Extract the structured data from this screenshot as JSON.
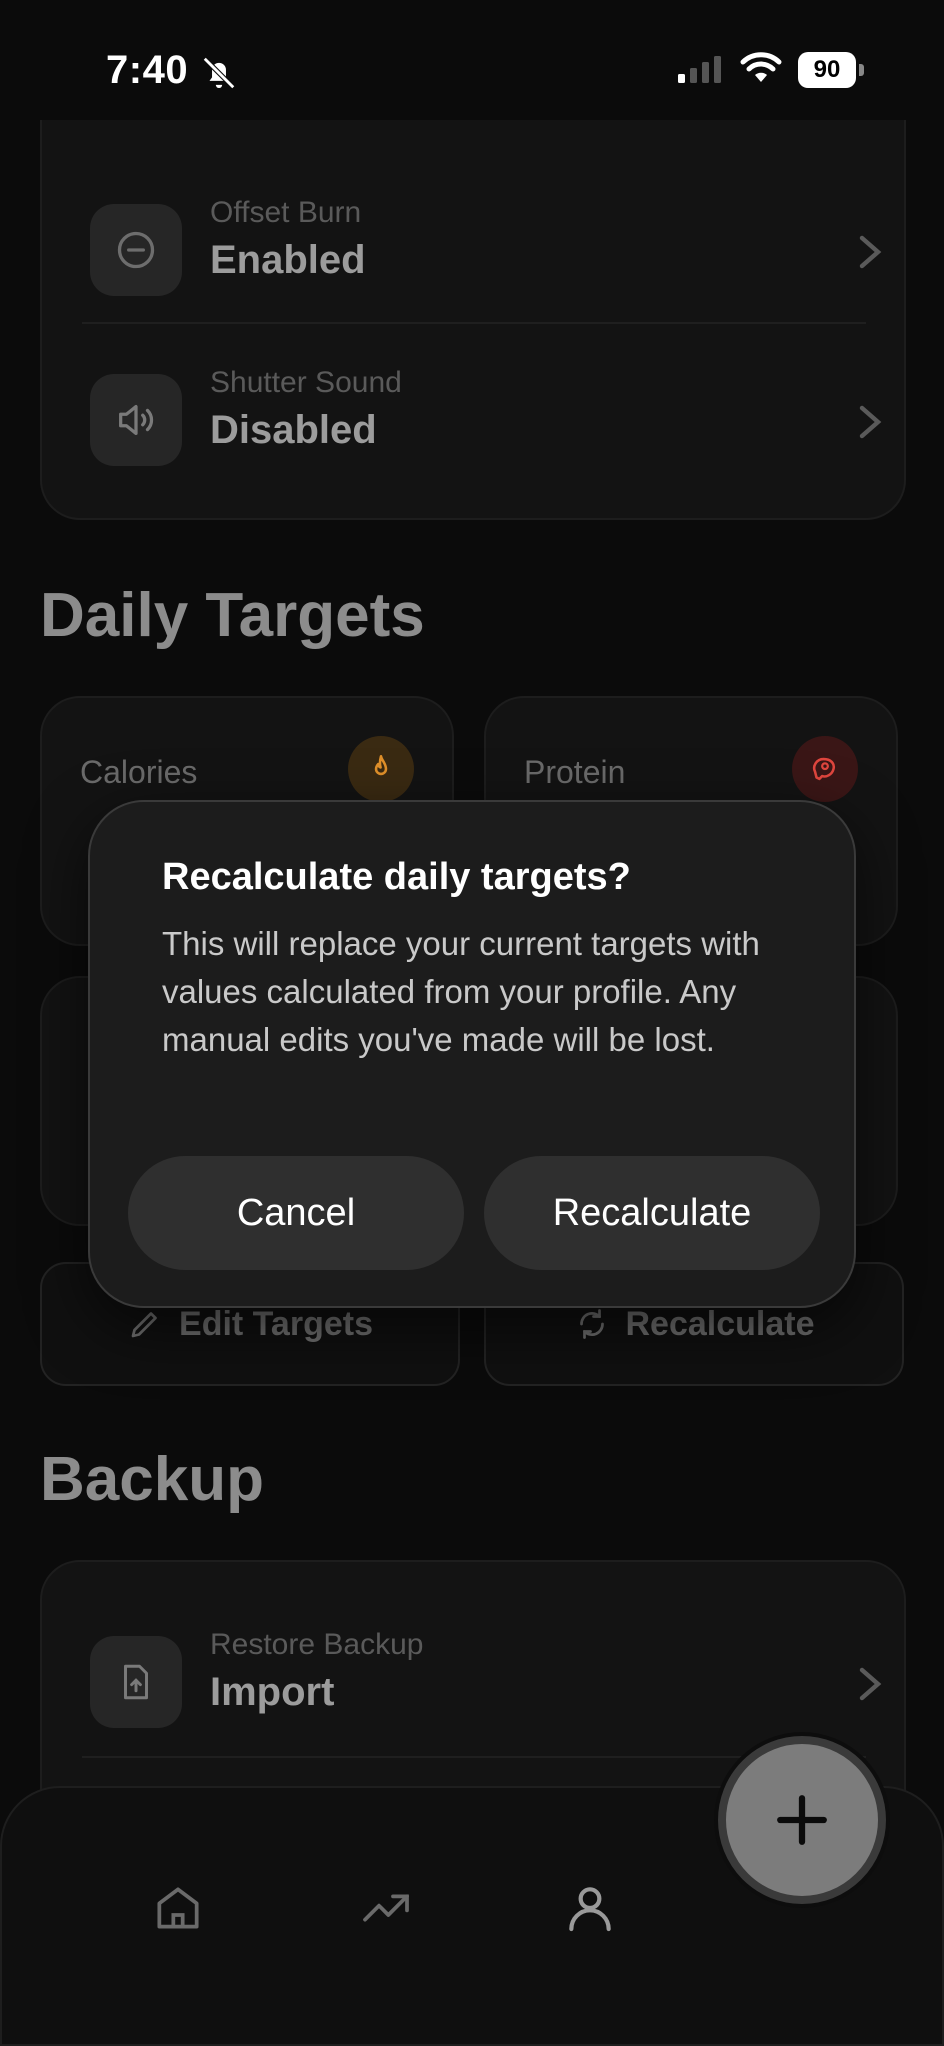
{
  "status_bar": {
    "time": "7:40",
    "battery": "90"
  },
  "settings": {
    "rows": [
      {
        "label": "Offset Burn",
        "value": "Enabled",
        "icon": "minus-circle-icon"
      },
      {
        "label": "Shutter Sound",
        "value": "Disabled",
        "icon": "speaker-icon"
      }
    ]
  },
  "daily_targets": {
    "title": "Daily Targets",
    "cards": [
      {
        "label": "Calories",
        "icon": "flame-icon",
        "accent": "#e0902a"
      },
      {
        "label": "Protein",
        "icon": "meat-icon",
        "accent": "#e0463e"
      }
    ],
    "edit_label": "Edit Targets",
    "recalc_label": "Recalculate"
  },
  "backup": {
    "title": "Backup",
    "rows": [
      {
        "label": "Restore Backup",
        "value": "Import",
        "icon": "file-upload-icon"
      }
    ]
  },
  "dialog": {
    "title": "Recalculate daily targets?",
    "body": "This will replace your current targets with values calculated from your profile. Any manual edits you've made will be lost.",
    "cancel_label": "Cancel",
    "confirm_label": "Recalculate"
  },
  "tab_bar": {
    "items": [
      {
        "icon": "home-icon"
      },
      {
        "icon": "trending-icon"
      },
      {
        "icon": "profile-icon"
      }
    ]
  },
  "colors": {
    "background": "#0b0b0b",
    "dialog": "#1c1c1c"
  }
}
